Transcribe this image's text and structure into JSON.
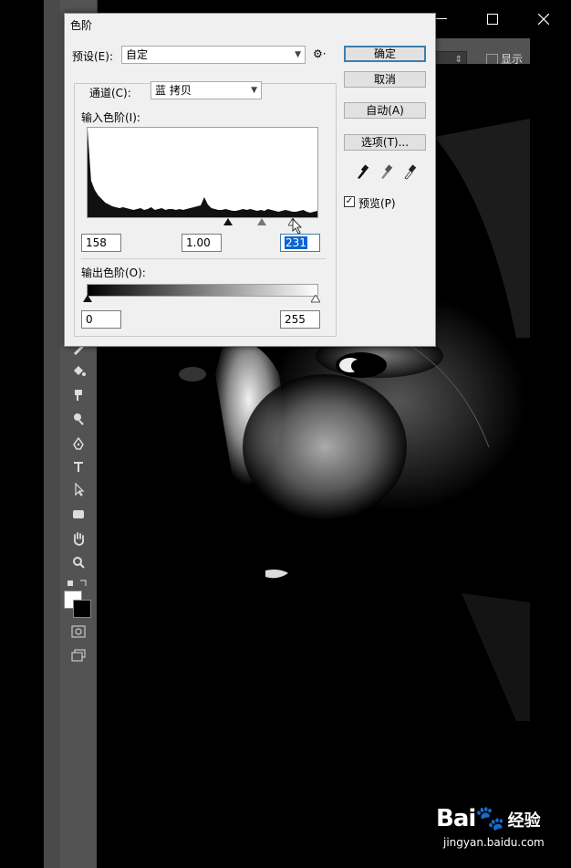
{
  "dialog": {
    "title": "色阶",
    "preset_label": "预设(E):",
    "preset_value": "自定",
    "channel_label": "通道(C):",
    "channel_value": "蓝 拷贝",
    "input_levels_label": "输入色阶(I):",
    "output_levels_label": "输出色阶(O):",
    "input_black": "158",
    "input_gamma": "1.00",
    "input_white": "231",
    "output_black": "0",
    "output_white": "255",
    "ok_button": "确定",
    "cancel_button": "取消",
    "auto_button": "自动(A)",
    "options_button": "选项(T)...",
    "preview_label": "预览(P)",
    "preview_checked": true
  },
  "options_bar": {
    "dropdown_value": "",
    "checkbox_label": "显示"
  },
  "watermark": {
    "brand": "Bai",
    "brand2": "经验",
    "url": "jingyan.baidu.com"
  },
  "histogram": [
    96,
    40,
    30,
    24,
    20,
    16,
    14,
    12,
    11,
    10,
    11,
    10,
    9,
    8,
    9,
    10,
    8,
    9,
    11,
    8,
    9,
    10,
    8,
    9,
    9,
    8,
    9,
    8,
    9,
    10,
    11,
    12,
    13,
    22,
    14,
    10,
    9,
    8,
    8,
    9,
    8,
    7,
    7,
    8,
    9,
    8,
    9,
    8,
    7,
    8,
    7,
    9,
    8,
    7,
    6,
    7,
    8,
    7,
    6,
    6,
    7,
    8,
    6,
    5,
    6,
    7
  ]
}
